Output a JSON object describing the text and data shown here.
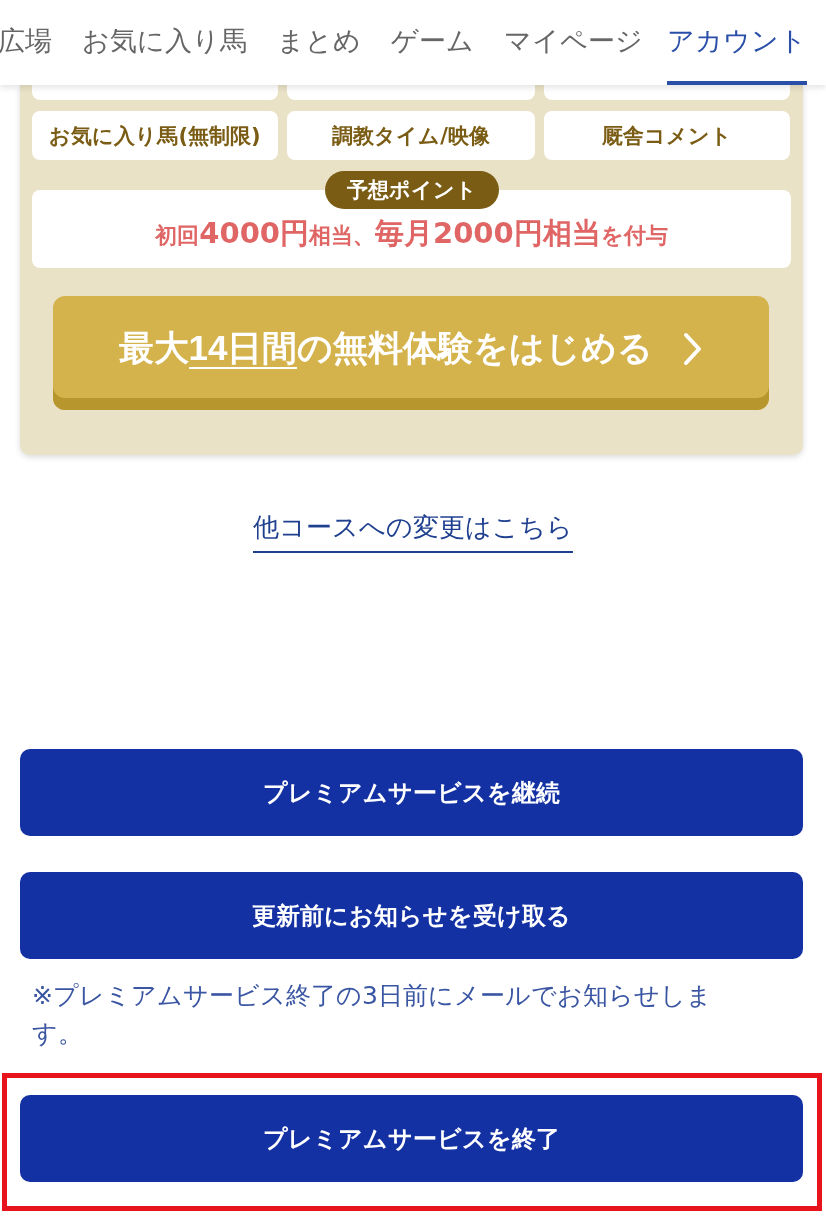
{
  "tabs": [
    {
      "label": "広場",
      "selected": false
    },
    {
      "label": "お気に入り馬",
      "selected": false
    },
    {
      "label": "まとめ",
      "selected": false
    },
    {
      "label": "ゲーム",
      "selected": false
    },
    {
      "label": "マイページ",
      "selected": false
    },
    {
      "label": "アカウント",
      "selected": true
    }
  ],
  "features": {
    "items": [
      "お気に入り馬(無制限)",
      "調教タイム/映像",
      "厩舎コメント"
    ]
  },
  "points": {
    "badge": "予想ポイント",
    "text": "初回**4000円**相当、**毎月2000円相当**を付与"
  },
  "trial_button": {
    "label": "最大**14日間**の無料体験をはじめる"
  },
  "course_link": "他コースへの変更はこちら",
  "actions": [
    {
      "label": "プレミアムサービスを継続",
      "highlighted": false
    },
    {
      "label": "更新前にお知らせを受け取る",
      "note": "※プレミアムサービス終了の3日前にメールでお知らせします。",
      "highlighted": false
    },
    {
      "label": "プレミアムサービスを終了",
      "highlighted": true
    }
  ]
}
